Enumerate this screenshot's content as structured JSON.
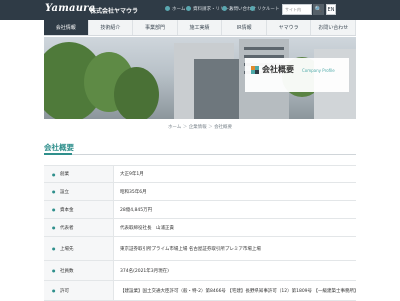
{
  "header": {
    "logo": "Yamaura",
    "company": "株式会社ヤマウラ",
    "links": [
      {
        "label": "ホーム"
      },
      {
        "label": "資料請求・リリース"
      },
      {
        "label": "お問い合わせ"
      },
      {
        "label": "リクルート"
      }
    ],
    "search_placeholder": "サイト内",
    "search_button": "🔍",
    "lang_button": "EN"
  },
  "nav": {
    "items": [
      {
        "label": "会社情報",
        "active": true
      },
      {
        "label": "技術紹介"
      },
      {
        "label": "事業部門"
      },
      {
        "label": "施工実績"
      },
      {
        "label": "IR情報"
      },
      {
        "label": "ヤマウラ"
      },
      {
        "label": "お問い合わせ"
      }
    ]
  },
  "hero": {
    "title": "会社概要",
    "subtitle": "Company Profile"
  },
  "breadcrumb": {
    "items": [
      "ホーム",
      "企業情報",
      "会社概要"
    ],
    "separator": "＞"
  },
  "page_title": "会社概要",
  "profile": {
    "rows": [
      {
        "label": "創業",
        "value": "大正9年1月"
      },
      {
        "label": "設立",
        "value": "昭和35年6月"
      },
      {
        "label": "資本金",
        "value": "28億4,845万円"
      },
      {
        "label": "代表者",
        "value": "代表取締役社長　山浦正貴"
      },
      {
        "label": "上場先",
        "value": "東京証券取引所プライム市場上場 名古屋証券取引所プレミア市場上場"
      },
      {
        "label": "社員数",
        "value": "374名(2021年3月現在)"
      },
      {
        "label": "許可",
        "value": "【建設業】国土交通大臣許可（般・特-2）第8466号 【宅建】長野県知事許可（12）第1809号 【一級建築士事務所】"
      }
    ]
  },
  "colors": {
    "topbar": "#2f3b46",
    "accent": "#2f8f8c",
    "nav_active": "#2f3b46"
  }
}
